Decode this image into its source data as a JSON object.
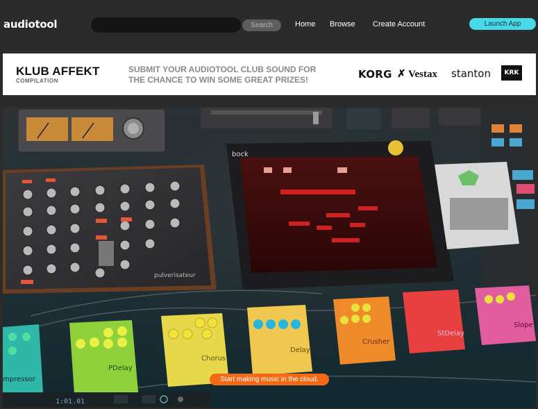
{
  "header": {
    "logo": "audiotool",
    "search": {
      "placeholder": "",
      "button_label": "Search"
    },
    "nav": [
      {
        "label": "Home"
      },
      {
        "label": "Browse"
      },
      {
        "label": "Create Account"
      }
    ],
    "launch_label": "Launch App"
  },
  "banner": {
    "title": "KLUB AFFEKT",
    "subtitle": "COMPILATION",
    "text_line1": "SUBMIT YOUR AUDIOTOOL CLUB SOUND FOR",
    "text_line2": "THE CHANCE TO WIN SOME GREAT PRIZES!",
    "sponsors": [
      "KORG",
      "Vestax",
      "stanton",
      "KRK"
    ]
  },
  "hero": {
    "device_labels": {
      "mixer": "pulverisateur",
      "sequencer": "bock",
      "pedal1": "mpressor",
      "pedal2": "PDelay",
      "pedal3": "Chorus",
      "pedal4": "Delay",
      "pedal5": "Crusher",
      "pedal6": "StDelay",
      "pedal7": "Slope"
    },
    "timecode": "1:01.01",
    "cta_label": "Start making music in the cloud."
  },
  "colors": {
    "accent_cyan": "#49d8e8",
    "cta_orange": "#f36a16",
    "background": "#2b2b2b"
  }
}
